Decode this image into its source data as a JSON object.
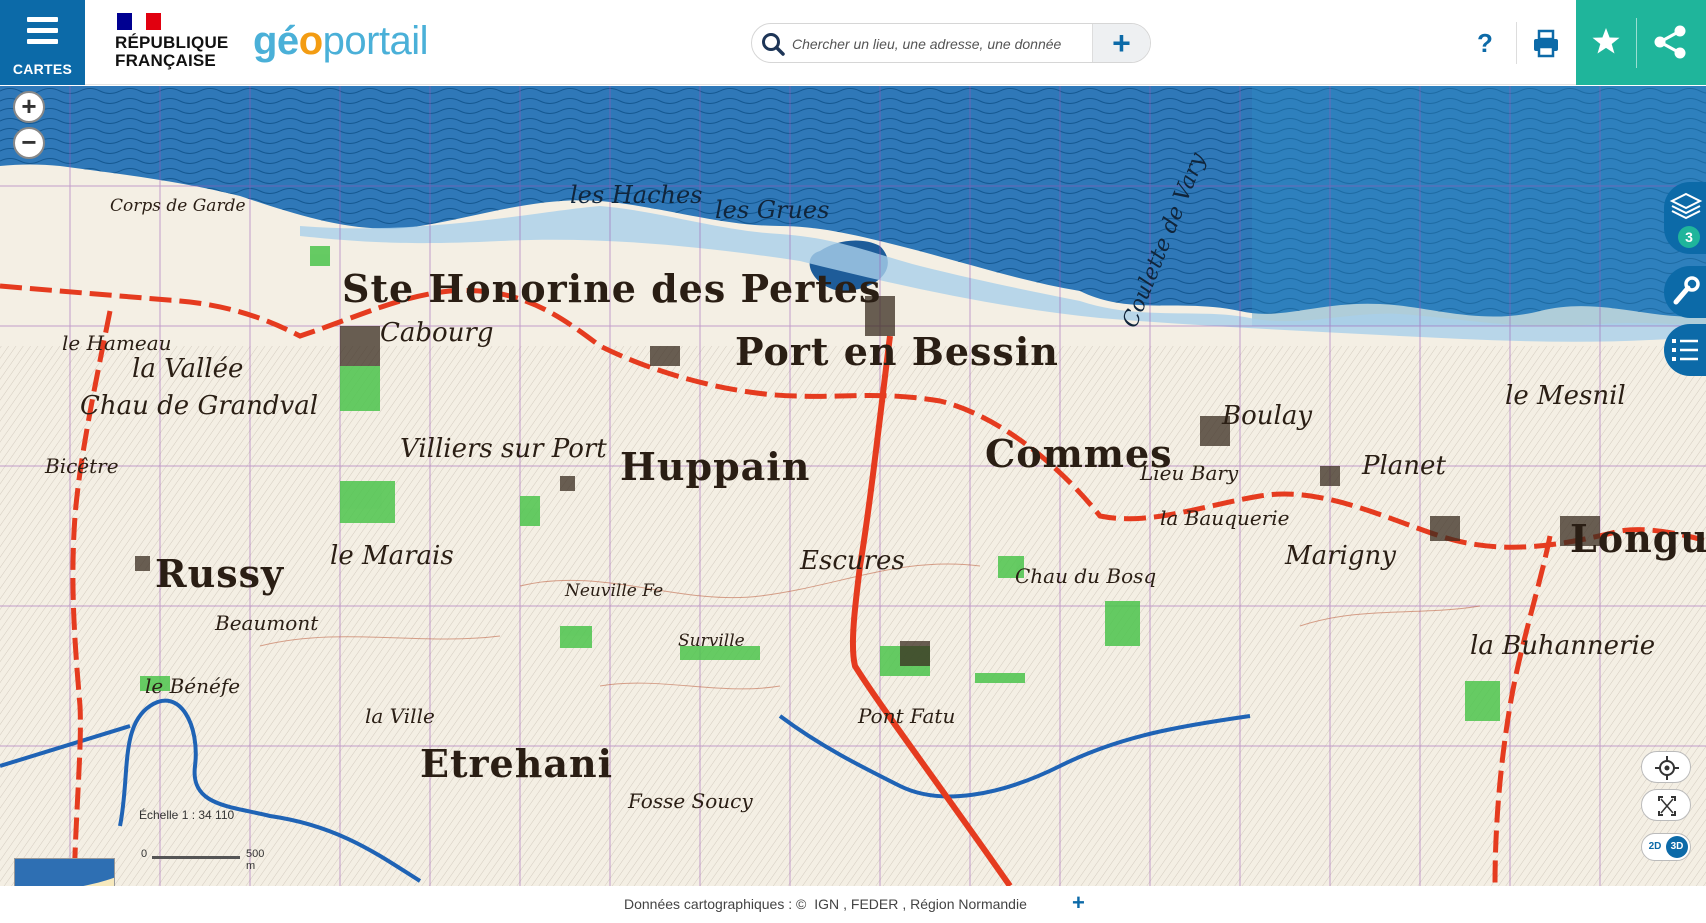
{
  "header": {
    "menu_label": "CARTES",
    "republique_line1": "RÉPUBLIQUE",
    "republique_line2": "FRANÇAISE",
    "logo_part1": "gé",
    "logo_part2": "o",
    "logo_part3": "portail",
    "search_placeholder": "Chercher un lieu, une adresse, une donnée",
    "help_label": "?"
  },
  "map": {
    "layers_count": "3",
    "zoom_in": "+",
    "zoom_out": "−",
    "view_2d": "2D",
    "view_3d": "3D",
    "scale_text": "Échelle 1 : 34 110",
    "scale_zero": "0",
    "scale_max": "500 m",
    "place_labels": [
      "Ste Honorine des Pertes",
      "Port en Bessin",
      "Huppain",
      "Commes",
      "Russy",
      "Etrehani",
      "Longues",
      "Cabourg",
      "la Vallée",
      "Chau de Grandval",
      "Villiers sur Port",
      "Escures",
      "le Marais",
      "Planet",
      "le Mesnil",
      "Boulay",
      "la Buhannerie",
      "Marigny",
      "les Haches",
      "les Grues",
      "Corps de Garde",
      "Bicêtre",
      "le Hameau",
      "Pont Fatu",
      "Fosse Soucy",
      "Beaumont",
      "la Ville",
      "le Bénéfe",
      "Chau du Bosq",
      "Lieu Bary",
      "la Bauquerie",
      "Surville",
      "Neuville Fe"
    ],
    "sea_label": "Coulette de Vary"
  },
  "footer": {
    "attribution_prefix": "Données cartographiques : ©",
    "sources": [
      "IGN",
      "FEDER",
      "Région Normandie"
    ],
    "more": "+"
  }
}
